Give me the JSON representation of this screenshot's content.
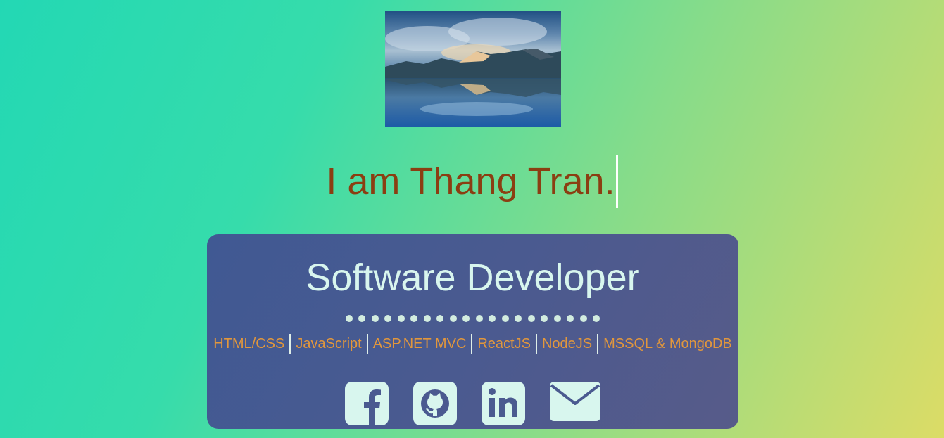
{
  "hero": {
    "image_subject": "mountain lake landscape with reflection",
    "image_icon": "landscape-photo"
  },
  "intro": {
    "text": "I am Thang Tran."
  },
  "card": {
    "title": "Software Developer",
    "dot_count": 20,
    "skills": [
      "HTML/CSS",
      "JavaScript",
      "ASP.NET MVC",
      "ReactJS",
      "NodeJS",
      "MSSQL & MongoDB"
    ],
    "socials": [
      {
        "name": "facebook",
        "icon": "facebook-icon"
      },
      {
        "name": "github",
        "icon": "github-icon"
      },
      {
        "name": "linkedin",
        "icon": "linkedin-icon"
      },
      {
        "name": "email",
        "icon": "email-icon"
      }
    ]
  },
  "colors": {
    "intro_text": "#8b3e12",
    "card_title": "#d8f6ee",
    "skill_text": "#e2973c",
    "card_bg": "#4a5a90",
    "icon_fill": "#d8f6ee"
  }
}
